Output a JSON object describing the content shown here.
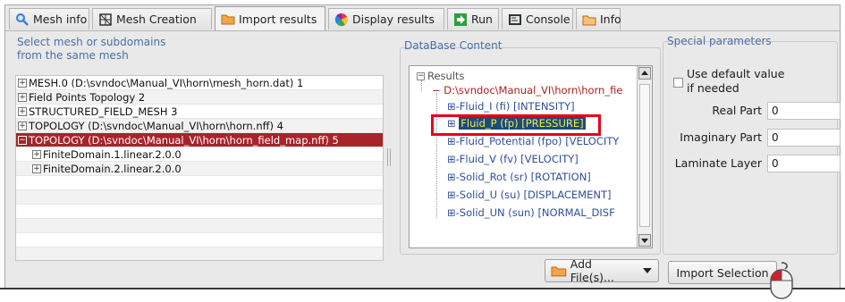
{
  "tabs": [
    {
      "label": "Mesh info",
      "icon": "magnifier-icon"
    },
    {
      "label": "Mesh Creation",
      "icon": "mesh-grid-icon"
    },
    {
      "label": "Import results",
      "icon": "folder-icon",
      "active": true
    },
    {
      "label": "Display results",
      "icon": "color-wheel-icon"
    },
    {
      "label": "Run",
      "icon": "run-arrow-icon"
    },
    {
      "label": "Console",
      "icon": "console-icon"
    },
    {
      "label": "Info",
      "icon": "info-folder-icon"
    }
  ],
  "left": {
    "title_line1": "Select mesh or subdomains",
    "title_line2": "from the same mesh",
    "rows": [
      {
        "label": "MESH.0 (D:\\svndoc\\Manual_VI\\horn\\mesh_horn.dat) 1",
        "expander": "⊞"
      },
      {
        "label": "Field Points Topology 2",
        "expander": "⊞"
      },
      {
        "label": "STRUCTURED_FIELD_MESH 3",
        "expander": "⊞"
      },
      {
        "label": "TOPOLOGY (D:\\svndoc\\Manual_VI\\horn\\horn.nff) 4",
        "expander": "⊞"
      },
      {
        "label": "TOPOLOGY (D:\\svndoc\\Manual_VI\\horn\\horn_field_map.nff) 5",
        "expander": "⊟",
        "selected": true
      },
      {
        "label": "FiniteDomain.1.linear.2.0.0",
        "expander": "⊞",
        "child": true
      },
      {
        "label": "FiniteDomain.2.linear.2.0.0",
        "expander": "⊞",
        "child": true
      }
    ]
  },
  "db": {
    "title": "DataBase Content",
    "root": "Results",
    "path": "D:\\svndoc\\Manual_VI\\horn\\horn_fie",
    "fields": [
      "Fluid_I (fi) [INTENSITY]",
      "Fluid_P (fp) [PRESSURE]",
      "Fluid_Potential (fpo) [VELOCITY",
      "Fluid_V (fv) [VELOCITY]",
      "Solid_Rot (sr) [ROTATION]",
      "Solid_U (su) [DISPLACEMENT]",
      "Solid_UN (sun) [NORMAL_DISF"
    ],
    "selected_index": 1
  },
  "params": {
    "title": "Special parameters",
    "use_default_line1": "Use default value",
    "use_default_line2": "if needed",
    "real_part_label": "Real Part",
    "real_part_value": "0",
    "imag_part_label": "Imaginary Part",
    "imag_part_value": "0",
    "laminate_label": "Laminate Layer",
    "laminate_value": "0"
  },
  "buttons": {
    "add_files": "Add File(s)...",
    "import_selection": "Import Selection"
  },
  "colors": {
    "selected_row": "#a8232a",
    "highlight_box": "#e8001a",
    "tree_selection_bg": "#1a4d7a",
    "tree_selection_fg": "#f7e74a"
  }
}
